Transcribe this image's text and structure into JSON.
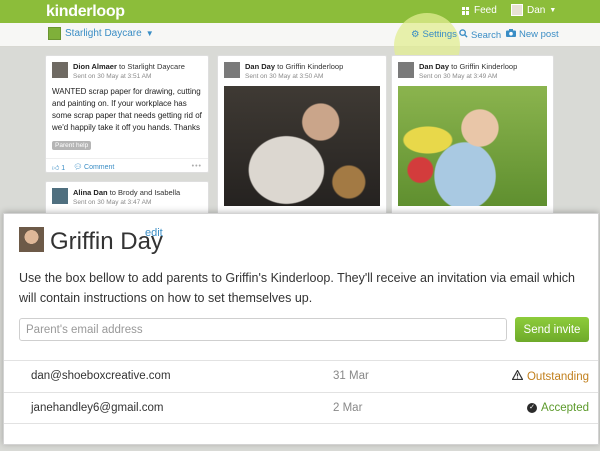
{
  "topbar": {
    "logo": "kinderloop",
    "feed_label": "Feed",
    "user_label": "Dan"
  },
  "subbar": {
    "group": "Starlight Daycare",
    "settings": "Settings",
    "search": "Search",
    "new_post": "New post"
  },
  "feed": {
    "col1": [
      {
        "author": "Dion Almaer",
        "to": "Starlight Daycare",
        "sent": "Sent on 30 May at 3:51 AM",
        "text": "WANTED scrap paper for drawing, cutting and painting on. If your workplace has some scrap paper that needs getting rid of we'd happily take it off you hands. Thanks",
        "tag": "Parent help",
        "likes": "1",
        "comment_label": "Comment"
      },
      {
        "author": "Alina Dan",
        "to": "Brody and Isabella",
        "sent": "Sent on 30 May at 3:47 AM"
      }
    ],
    "col2": {
      "author": "Dan Day",
      "to": "Griffin Kinderloop",
      "sent": "Sent on 30 May at 3:50 AM"
    },
    "col3": {
      "author": "Dan Day",
      "to": "Griffin Kinderloop",
      "sent": "Sent on 30 May at 3:49 AM"
    },
    "to_word": "to"
  },
  "modal": {
    "title": "Griffin Day",
    "edit": "edit",
    "description": "Use the box bellow to add parents to Griffin's Kinderloop. They'll receive an invitation via email which will contain instructions on how to set themselves up.",
    "email_placeholder": "Parent's email address",
    "send_button": "Send invite",
    "invites": [
      {
        "email": "dan@shoeboxcreative.com",
        "date": "31 Mar",
        "status": "Outstanding",
        "status_color": "#c17f1c",
        "icon": "warning-icon"
      },
      {
        "email": "janehandley6@gmail.com",
        "date": "2 Mar",
        "status": "Accepted",
        "status_color": "#5c9a2b",
        "icon": "check-circle-icon"
      }
    ]
  },
  "colors": {
    "brand": "#8cbd3a",
    "link": "#3a8dc5"
  }
}
